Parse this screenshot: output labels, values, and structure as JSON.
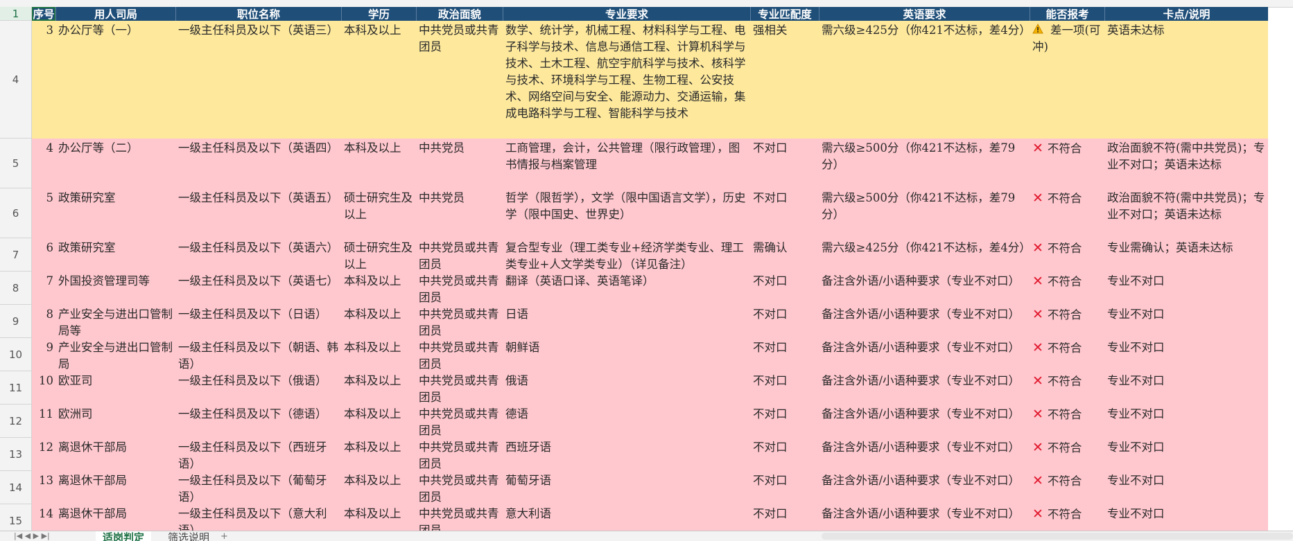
{
  "header": {
    "col_a": "序号",
    "col_b": "用人司局",
    "col_c": "职位名称",
    "col_d": "学历",
    "col_e": "政治面貌",
    "col_f": "专业要求",
    "col_g": "专业匹配度",
    "col_h": "英语要求",
    "col_i": "能否报考",
    "col_j": "卡点/说明"
  },
  "row_numbers": [
    "1",
    "4",
    "5",
    "6",
    "7",
    "8",
    "9",
    "10",
    "11",
    "12",
    "13",
    "14",
    "15"
  ],
  "rows": [
    {
      "no": "3",
      "dept": "办公厅等（一）",
      "title": "一级主任科员及以下（英语三）",
      "edu": "本科及以上",
      "pol": "中共党员或共青团员",
      "major": "数学、统计学，机械工程、材料科学与工程、电子科学与技术、信息与通信工程、计算机科学与技术、土木工程、航空宇航科学与技术、核科学与技术、环境科学与工程、生物工程、公安技术、网络空间与安全、能源动力、交通运输，集成电路科学与工程、智能科学与技术",
      "match": "强相关",
      "english": "需六级≥425分（你421不达标，差4分）",
      "can": "差一项(可冲)",
      "note": "英语未达标",
      "status": "warn"
    },
    {
      "no": "4",
      "dept": "办公厅等（二）",
      "title": "一级主任科员及以下（英语四）",
      "edu": "本科及以上",
      "pol": "中共党员",
      "major": "工商管理，会计，公共管理（限行政管理），图书情报与档案管理",
      "match": "不对口",
      "english": "需六级≥500分（你421不达标，差79分）",
      "can": "不符合",
      "note": "政治面貌不符(需中共党员)；专业不对口；英语未达标",
      "status": "no"
    },
    {
      "no": "5",
      "dept": "政策研究室",
      "title": "一级主任科员及以下（英语五）",
      "edu": "硕士研究生及以上",
      "pol": "中共党员",
      "major": "哲学（限哲学），文学（限中国语言文学），历史学（限中国史、世界史）",
      "match": "不对口",
      "english": "需六级≥500分（你421不达标，差79分）",
      "can": "不符合",
      "note": "政治面貌不符(需中共党员)；专业不对口；英语未达标",
      "status": "no"
    },
    {
      "no": "6",
      "dept": "政策研究室",
      "title": "一级主任科员及以下（英语六）",
      "edu": "硕士研究生及以上",
      "pol": "中共党员或共青团员",
      "major": "复合型专业（理工类专业+经济学类专业、理工类专业+人文学类专业）（详见备注）",
      "match": "需确认",
      "english": "需六级≥425分（你421不达标，差4分）",
      "can": "不符合",
      "note": "专业需确认；英语未达标",
      "status": "no"
    },
    {
      "no": "7",
      "dept": "外国投资管理司等",
      "title": "一级主任科员及以下（英语七）",
      "edu": "本科及以上",
      "pol": "中共党员或共青团员",
      "major": "翻译（英语口译、英语笔译）",
      "match": "不对口",
      "english": "备注含外语/小语种要求（专业不对口）",
      "can": "不符合",
      "note": "专业不对口",
      "status": "no"
    },
    {
      "no": "8",
      "dept": "产业安全与进出口管制局等",
      "title": "一级主任科员及以下（日语）",
      "edu": "本科及以上",
      "pol": "中共党员或共青团员",
      "major": "日语",
      "match": "不对口",
      "english": "备注含外语/小语种要求（专业不对口）",
      "can": "不符合",
      "note": "专业不对口",
      "status": "no"
    },
    {
      "no": "9",
      "dept": "产业安全与进出口管制局",
      "title": "一级主任科员及以下（朝语、韩语）",
      "edu": "本科及以上",
      "pol": "中共党员或共青团员",
      "major": "朝鲜语",
      "match": "不对口",
      "english": "备注含外语/小语种要求（专业不对口）",
      "can": "不符合",
      "note": "专业不对口",
      "status": "no"
    },
    {
      "no": "10",
      "dept": "欧亚司",
      "title": "一级主任科员及以下（俄语）",
      "edu": "本科及以上",
      "pol": "中共党员或共青团员",
      "major": "俄语",
      "match": "不对口",
      "english": "备注含外语/小语种要求（专业不对口）",
      "can": "不符合",
      "note": "专业不对口",
      "status": "no"
    },
    {
      "no": "11",
      "dept": "欧洲司",
      "title": "一级主任科员及以下（德语）",
      "edu": "本科及以上",
      "pol": "中共党员或共青团员",
      "major": "德语",
      "match": "不对口",
      "english": "备注含外语/小语种要求（专业不对口）",
      "can": "不符合",
      "note": "专业不对口",
      "status": "no"
    },
    {
      "no": "12",
      "dept": "离退休干部局",
      "title": "一级主任科员及以下（西班牙语）",
      "edu": "本科及以上",
      "pol": "中共党员或共青团员",
      "major": "西班牙语",
      "match": "不对口",
      "english": "备注含外语/小语种要求（专业不对口）",
      "can": "不符合",
      "note": "专业不对口",
      "status": "no"
    },
    {
      "no": "13",
      "dept": "离退休干部局",
      "title": "一级主任科员及以下（葡萄牙语）",
      "edu": "本科及以上",
      "pol": "中共党员或共青团员",
      "major": "葡萄牙语",
      "match": "不对口",
      "english": "备注含外语/小语种要求（专业不对口）",
      "can": "不符合",
      "note": "专业不对口",
      "status": "no"
    },
    {
      "no": "14",
      "dept": "离退休干部局",
      "title": "一级主任科员及以下（意大利语）",
      "edu": "本科及以上",
      "pol": "中共党员或共青团员",
      "major": "意大利语",
      "match": "不对口",
      "english": "备注含外语/小语种要求（专业不对口）",
      "can": "不符合",
      "note": "专业不对口",
      "status": "no"
    }
  ],
  "icons": {
    "warn": "warning-icon",
    "no": "cross-mark-icon"
  },
  "colors": {
    "header_bg": "#1f4e78",
    "yellow": "#fde89c",
    "pink": "#ffc7ce",
    "cross": "#e0182d",
    "select": "#1e7145"
  },
  "tabs": [
    "适岗判定",
    "筛选说明"
  ]
}
